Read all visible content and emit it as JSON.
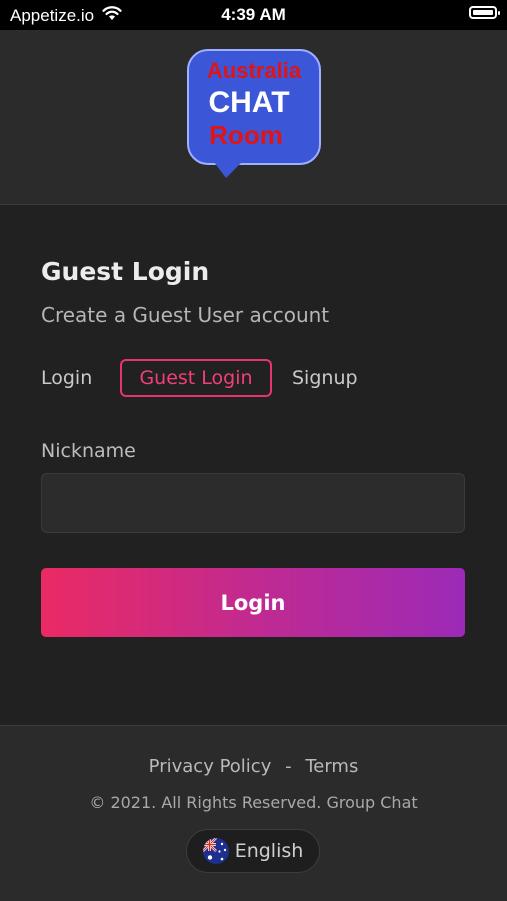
{
  "status_bar": {
    "carrier": "Appetize.io",
    "time": "4:39 AM",
    "icons": [
      "wifi-icon",
      "battery-icon"
    ]
  },
  "logo": {
    "line1": "Australia",
    "line2": "CHAT",
    "line3": "Room",
    "colors": {
      "bubble": "#3c56d8",
      "text_red": "#e01414",
      "text_white": "#ffffff"
    }
  },
  "form": {
    "heading": "Guest Login",
    "subheading": "Create a Guest User account",
    "tabs": [
      {
        "label": "Login",
        "active": false
      },
      {
        "label": "Guest Login",
        "active": true
      },
      {
        "label": "Signup",
        "active": false
      }
    ],
    "nickname_label": "Nickname",
    "nickname_value": "",
    "nickname_placeholder": "",
    "submit_label": "Login"
  },
  "footer": {
    "privacy_label": "Privacy Policy",
    "separator": "-",
    "terms_label": "Terms",
    "copyright": "© 2021. All Rights Reserved. Group Chat",
    "language_label": "English",
    "language_icon": "australia-flag-icon"
  },
  "colors": {
    "accent": "#e8346c",
    "gradient_start": "#ea2a64",
    "gradient_end": "#9c2ab7",
    "background": "#212121"
  }
}
